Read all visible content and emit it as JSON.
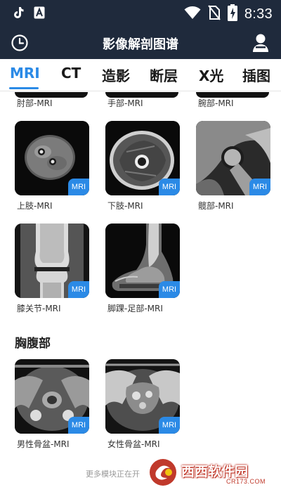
{
  "status_bar": {
    "time": "8:33",
    "left_icons": [
      "tiktok-icon",
      "font-a-icon"
    ],
    "right_icons": [
      "wifi-icon",
      "no-sim-icon",
      "battery-charging-icon"
    ]
  },
  "app_bar": {
    "title": "影像解剖图谱",
    "left_icon": "history-clock-icon",
    "right_icon": "user-icon"
  },
  "tabs": [
    {
      "label": "MRI",
      "active": true
    },
    {
      "label": "CT",
      "active": false
    },
    {
      "label": "造影",
      "active": false
    },
    {
      "label": "断层",
      "active": false
    },
    {
      "label": "X光",
      "active": false
    },
    {
      "label": "插图",
      "active": false
    }
  ],
  "partial_row_labels": [
    "肘部-MRI",
    "手部-MRI",
    "腕部-MRI"
  ],
  "limbs_items": [
    {
      "label": "上肢-MRI",
      "badge": "MRI"
    },
    {
      "label": "下肢-MRI",
      "badge": "MRI"
    },
    {
      "label": "髋部-MRI",
      "badge": "MRI"
    },
    {
      "label": "膝关节-MRI",
      "badge": "MRI"
    },
    {
      "label": "脚踝-足部-MRI",
      "badge": "MRI"
    }
  ],
  "section_chest_abdomen": {
    "title": "胸腹部",
    "items": [
      {
        "label": "男性骨盆-MRI",
        "badge": "MRI"
      },
      {
        "label": "女性骨盆-MRI",
        "badge": "MRI"
      }
    ]
  },
  "footer": "更多模块正在开",
  "watermark": {
    "text": "西西软件园",
    "sub": "CR173.COM"
  },
  "colors": {
    "header_bg": "#1f2a3c",
    "accent": "#2b8ae6"
  }
}
